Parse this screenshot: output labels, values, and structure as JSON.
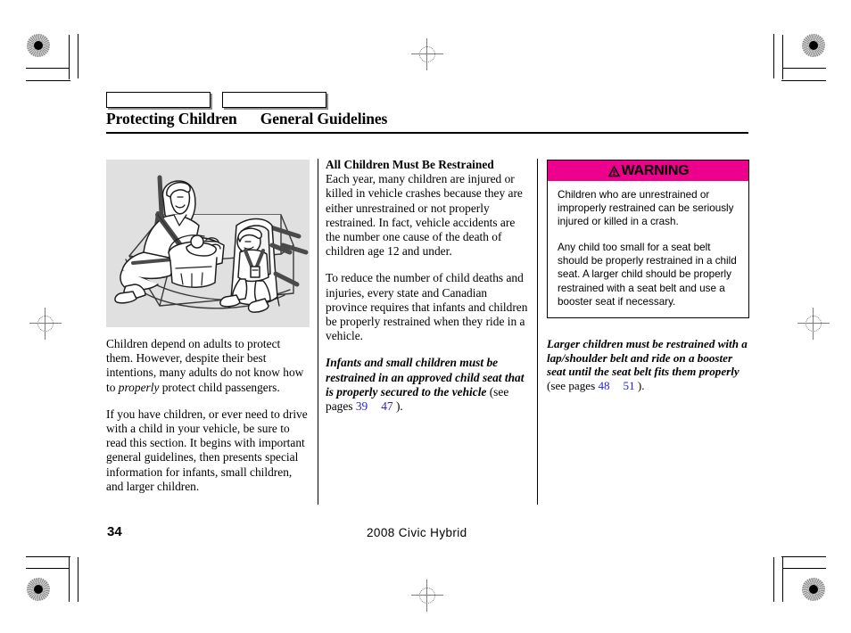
{
  "document": {
    "section_title": "Protecting Children",
    "subsection_title": "General Guidelines",
    "page_number": "34",
    "model_footer": "2008  Civic  Hybrid"
  },
  "tabs": [
    {
      "name": "tab-1",
      "label": ""
    },
    {
      "name": "tab-2",
      "label": ""
    }
  ],
  "left_column": {
    "illustration_caption": "",
    "paragraphs": [
      "Children depend on adults to protect them. However, despite their best intentions, many adults do not know how to ",
      "If you have children, or ever need to drive with a child in your vehicle, be sure to read this section. It begins with important general guidelines, then presents special information for infants, small children, and larger children."
    ],
    "italic_word": "properly",
    "paragraph1_tail": " protect child passengers."
  },
  "middle_column": {
    "heading": "All Children Must Be Restrained",
    "paragraph1": "Each year, many children are injured or killed in vehicle crashes because they are either unrestrained or not properly restrained. In fact, vehicle accidents are the number one cause of the death of children age 12 and under.",
    "paragraph2": "To reduce the number of child deaths and injuries, every state and Canadian province requires that infants and children be properly restrained when they ride in a vehicle.",
    "emphasis": "Infants and small children must be restrained in an approved child seat that is properly secured to the vehicle",
    "ref_prefix": " (see pages ",
    "ref_page_1": "39",
    "ref_page_2": "47",
    "ref_suffix": " )."
  },
  "warning": {
    "title": "WARNING",
    "icon": "warning-triangle-icon",
    "banner_color": "#ec008c",
    "paragraph1": "Children who are unrestrained or improperly restrained can be seriously injured or killed in a crash.",
    "paragraph2": "Any child too small for a seat belt should be properly restrained in a child seat. A larger child should be properly restrained with a seat belt and use a booster seat if necessary."
  },
  "right_note": {
    "emphasis": "Larger children must be restrained with a lap/shoulder belt and ride on a booster seat until the seat belt fits them properly",
    "ref_prefix": " (see pages ",
    "ref_page_1": "48",
    "ref_page_2": "51",
    "ref_suffix": " )."
  },
  "colors": {
    "warning_magenta": "#ec008c",
    "page_link_blue": "#2222dd",
    "illustration_bg": "#e0e0e0"
  }
}
